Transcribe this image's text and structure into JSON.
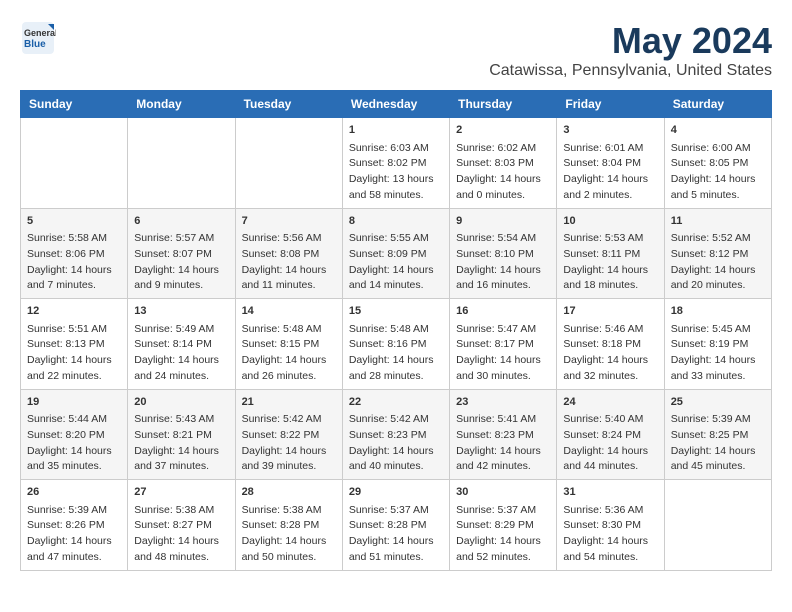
{
  "logo": {
    "general": "General",
    "blue": "Blue"
  },
  "title": "May 2024",
  "location": "Catawissa, Pennsylvania, United States",
  "weekdays": [
    "Sunday",
    "Monday",
    "Tuesday",
    "Wednesday",
    "Thursday",
    "Friday",
    "Saturday"
  ],
  "weeks": [
    [
      {
        "day": "",
        "info": ""
      },
      {
        "day": "",
        "info": ""
      },
      {
        "day": "",
        "info": ""
      },
      {
        "day": "1",
        "info": "Sunrise: 6:03 AM\nSunset: 8:02 PM\nDaylight: 13 hours and 58 minutes."
      },
      {
        "day": "2",
        "info": "Sunrise: 6:02 AM\nSunset: 8:03 PM\nDaylight: 14 hours and 0 minutes."
      },
      {
        "day": "3",
        "info": "Sunrise: 6:01 AM\nSunset: 8:04 PM\nDaylight: 14 hours and 2 minutes."
      },
      {
        "day": "4",
        "info": "Sunrise: 6:00 AM\nSunset: 8:05 PM\nDaylight: 14 hours and 5 minutes."
      }
    ],
    [
      {
        "day": "5",
        "info": "Sunrise: 5:58 AM\nSunset: 8:06 PM\nDaylight: 14 hours and 7 minutes."
      },
      {
        "day": "6",
        "info": "Sunrise: 5:57 AM\nSunset: 8:07 PM\nDaylight: 14 hours and 9 minutes."
      },
      {
        "day": "7",
        "info": "Sunrise: 5:56 AM\nSunset: 8:08 PM\nDaylight: 14 hours and 11 minutes."
      },
      {
        "day": "8",
        "info": "Sunrise: 5:55 AM\nSunset: 8:09 PM\nDaylight: 14 hours and 14 minutes."
      },
      {
        "day": "9",
        "info": "Sunrise: 5:54 AM\nSunset: 8:10 PM\nDaylight: 14 hours and 16 minutes."
      },
      {
        "day": "10",
        "info": "Sunrise: 5:53 AM\nSunset: 8:11 PM\nDaylight: 14 hours and 18 minutes."
      },
      {
        "day": "11",
        "info": "Sunrise: 5:52 AM\nSunset: 8:12 PM\nDaylight: 14 hours and 20 minutes."
      }
    ],
    [
      {
        "day": "12",
        "info": "Sunrise: 5:51 AM\nSunset: 8:13 PM\nDaylight: 14 hours and 22 minutes."
      },
      {
        "day": "13",
        "info": "Sunrise: 5:49 AM\nSunset: 8:14 PM\nDaylight: 14 hours and 24 minutes."
      },
      {
        "day": "14",
        "info": "Sunrise: 5:48 AM\nSunset: 8:15 PM\nDaylight: 14 hours and 26 minutes."
      },
      {
        "day": "15",
        "info": "Sunrise: 5:48 AM\nSunset: 8:16 PM\nDaylight: 14 hours and 28 minutes."
      },
      {
        "day": "16",
        "info": "Sunrise: 5:47 AM\nSunset: 8:17 PM\nDaylight: 14 hours and 30 minutes."
      },
      {
        "day": "17",
        "info": "Sunrise: 5:46 AM\nSunset: 8:18 PM\nDaylight: 14 hours and 32 minutes."
      },
      {
        "day": "18",
        "info": "Sunrise: 5:45 AM\nSunset: 8:19 PM\nDaylight: 14 hours and 33 minutes."
      }
    ],
    [
      {
        "day": "19",
        "info": "Sunrise: 5:44 AM\nSunset: 8:20 PM\nDaylight: 14 hours and 35 minutes."
      },
      {
        "day": "20",
        "info": "Sunrise: 5:43 AM\nSunset: 8:21 PM\nDaylight: 14 hours and 37 minutes."
      },
      {
        "day": "21",
        "info": "Sunrise: 5:42 AM\nSunset: 8:22 PM\nDaylight: 14 hours and 39 minutes."
      },
      {
        "day": "22",
        "info": "Sunrise: 5:42 AM\nSunset: 8:23 PM\nDaylight: 14 hours and 40 minutes."
      },
      {
        "day": "23",
        "info": "Sunrise: 5:41 AM\nSunset: 8:23 PM\nDaylight: 14 hours and 42 minutes."
      },
      {
        "day": "24",
        "info": "Sunrise: 5:40 AM\nSunset: 8:24 PM\nDaylight: 14 hours and 44 minutes."
      },
      {
        "day": "25",
        "info": "Sunrise: 5:39 AM\nSunset: 8:25 PM\nDaylight: 14 hours and 45 minutes."
      }
    ],
    [
      {
        "day": "26",
        "info": "Sunrise: 5:39 AM\nSunset: 8:26 PM\nDaylight: 14 hours and 47 minutes."
      },
      {
        "day": "27",
        "info": "Sunrise: 5:38 AM\nSunset: 8:27 PM\nDaylight: 14 hours and 48 minutes."
      },
      {
        "day": "28",
        "info": "Sunrise: 5:38 AM\nSunset: 8:28 PM\nDaylight: 14 hours and 50 minutes."
      },
      {
        "day": "29",
        "info": "Sunrise: 5:37 AM\nSunset: 8:28 PM\nDaylight: 14 hours and 51 minutes."
      },
      {
        "day": "30",
        "info": "Sunrise: 5:37 AM\nSunset: 8:29 PM\nDaylight: 14 hours and 52 minutes."
      },
      {
        "day": "31",
        "info": "Sunrise: 5:36 AM\nSunset: 8:30 PM\nDaylight: 14 hours and 54 minutes."
      },
      {
        "day": "",
        "info": ""
      }
    ]
  ]
}
